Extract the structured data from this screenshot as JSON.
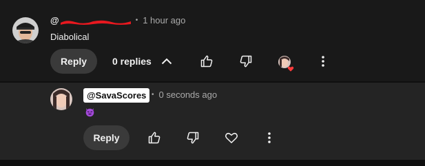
{
  "comment": {
    "handle": "@",
    "time": "1 hour ago",
    "text": "Diabolical",
    "reply_label": "Reply",
    "replies_toggle": "0 replies",
    "icons": [
      "like-icon",
      "dislike-icon",
      "creator-heart-icon",
      "more-vert-icon"
    ]
  },
  "reply": {
    "handle": "@SavaScores",
    "time": "0 seconds ago",
    "emoji": "smiling-devil-emoji",
    "reply_label": "Reply",
    "icons": [
      "like-icon",
      "dislike-icon",
      "heart-outline-icon",
      "more-vert-icon"
    ]
  },
  "colors": {
    "background": "#0f0f0f",
    "comment_bg": "#191919",
    "reply_bg": "#242424",
    "pill_bg": "#3a3a3a",
    "redaction": "#e8181f",
    "heart": "#ff3b3b",
    "secondary_text": "#aaaaaa"
  }
}
